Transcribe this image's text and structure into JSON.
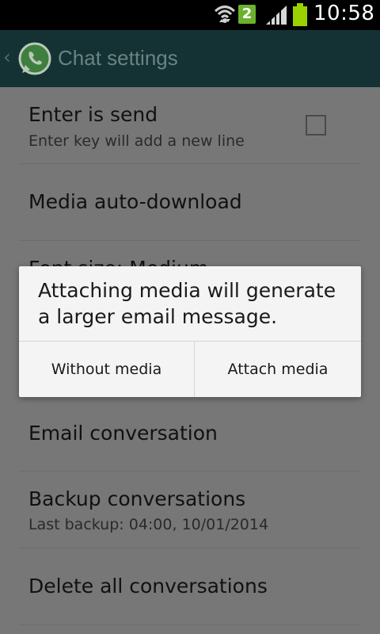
{
  "status_bar": {
    "time": "10:58",
    "notification_badge": "2",
    "icons": [
      "wifi-icon",
      "signal-icon",
      "battery-icon"
    ],
    "battery_color": "#9ad200"
  },
  "action_bar": {
    "title": "Chat settings",
    "background": "#143233"
  },
  "settings": {
    "items": [
      {
        "title": "Enter is send",
        "summary": "Enter key will add a new line",
        "checked": false
      },
      {
        "title": "Media auto-download"
      },
      {
        "title": "Font size: Medium"
      },
      {
        "title": "Email conversation"
      },
      {
        "title": "Backup conversations",
        "summary": "Last backup: 04:00, 10/01/2014"
      },
      {
        "title": "Delete all conversations"
      }
    ]
  },
  "dialog": {
    "message": "Attaching media will generate a larger email message.",
    "buttons": {
      "negative": "Without media",
      "positive": "Attach media"
    }
  }
}
